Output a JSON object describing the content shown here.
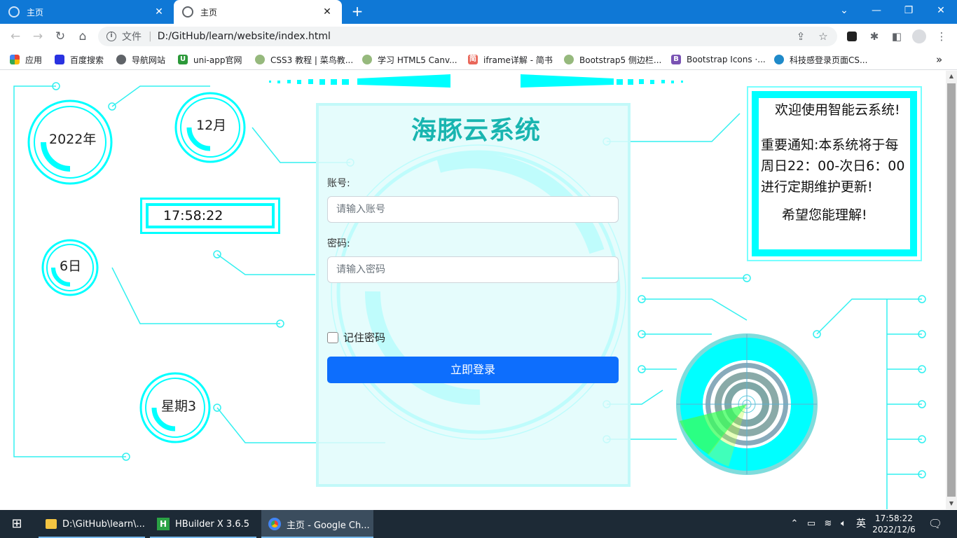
{
  "browser": {
    "tabs": [
      {
        "title": "主页",
        "state": "inactive"
      },
      {
        "title": "主页",
        "state": "active"
      }
    ],
    "new_tab": "+",
    "window_controls": {
      "dropdown": "⌄",
      "minimize": "—",
      "restore": "❐",
      "close": "✕"
    },
    "address": {
      "scheme_label": "文件",
      "separator": "|",
      "url": "D:/GitHub/learn/website/index.html"
    }
  },
  "bookmarks": [
    {
      "label": "应用",
      "icon": "apps-grid-icon",
      "color": "#e8453c"
    },
    {
      "label": "百度搜索",
      "icon": "baidu-paw-icon",
      "color": "#2932e1"
    },
    {
      "label": "导航网站",
      "icon": "globe-icon",
      "color": "#5f6368"
    },
    {
      "label": "uni-app官网",
      "icon": "uniapp-icon",
      "color": "#2b9939"
    },
    {
      "label": "CSS3 教程 | 菜鸟教...",
      "icon": "runoob-icon",
      "color": "#96b97d"
    },
    {
      "label": "学习 HTML5 Canv...",
      "icon": "runoob-icon",
      "color": "#96b97d"
    },
    {
      "label": "iframe详解 - 简书",
      "icon": "jianshu-icon",
      "color": "#e9675a"
    },
    {
      "label": "Bootstrap5 侧边栏...",
      "icon": "runoob-icon",
      "color": "#96b97d"
    },
    {
      "label": "Bootstrap Icons ·...",
      "icon": "bootstrap-icon",
      "color": "#7952b3"
    },
    {
      "label": "科技感登录页面CS...",
      "icon": "csdn-icon",
      "color": "#1f8ac9"
    }
  ],
  "bookmarks_more": "»",
  "dashboard": {
    "year": "2022年",
    "month": "12月",
    "time": "17:58:22",
    "day": "6日",
    "weekday": "星期3"
  },
  "login": {
    "title": "海豚云系统",
    "account_label": "账号:",
    "account_placeholder": "请输入账号",
    "password_label": "密码:",
    "password_placeholder": "请输入密码",
    "remember_label": "记住密码",
    "submit_label": "立即登录"
  },
  "notice": {
    "welcome": "欢迎使用智能云系统!",
    "line1": "重要通知:本系统将于每",
    "line2": "周日22：00-次日6：00",
    "line3": "进行定期维护更新!",
    "closing": "希望您能理解!"
  },
  "colors": {
    "accent_cyan": "#00ffff",
    "title_teal": "#19b5b0",
    "button_blue": "#0d6efd",
    "chrome_blue": "#0f78d6"
  },
  "taskbar": {
    "items": [
      {
        "label": "D:\\GitHub\\learn\\...",
        "icon": "folder-icon"
      },
      {
        "label": "HBuilder X 3.6.5",
        "icon": "hbuilder-icon"
      },
      {
        "label": "主页 - Google Ch...",
        "icon": "chrome-icon"
      }
    ],
    "ime": "英",
    "clock_time": "17:58:22",
    "clock_date": "2022/12/6"
  }
}
